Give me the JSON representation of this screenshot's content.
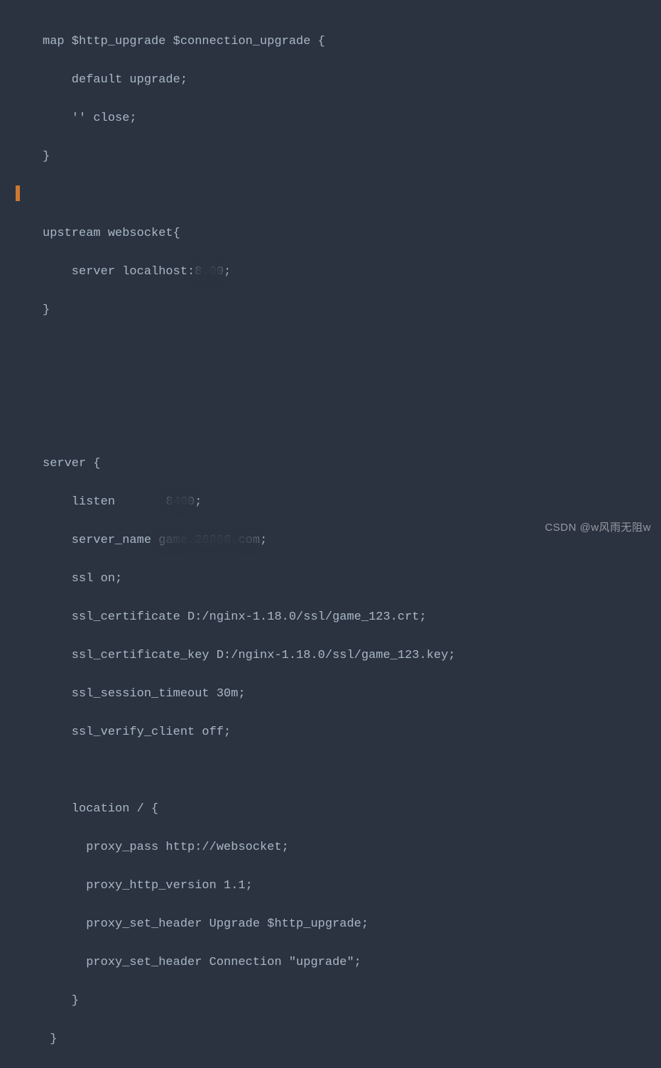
{
  "code": {
    "lines": [
      "map $http_upgrade $connection_upgrade {",
      "    default upgrade;",
      "    '' close;",
      "}",
      "",
      "upstream websocket{",
      "    server localhost:",
      "}",
      "",
      "",
      "",
      "server {",
      "    listen       ",
      "    server_name ",
      "    ssl on;",
      "    ssl_certificate D:/nginx-1.18.0/ssl/game_123.crt;",
      "    ssl_certificate_key D:/nginx-1.18.0/ssl/game_123.key;",
      "    ssl_session_timeout 30m;",
      "    ssl_verify_client off;",
      "    ",
      "    location / {",
      "      proxy_pass http://websocket;",
      "      proxy_http_version 1.1;",
      "      proxy_set_header Upgrade $http_upgrade;",
      "      proxy_set_header Connection \"upgrade\";",
      "    }",
      " }"
    ],
    "redacted": {
      "line6_suffix": "8.00",
      "line6_end": ";",
      "line12_suffix": "8400",
      "line12_end": ";",
      "line13_suffix": "game.26866.com",
      "line13_end": ";"
    }
  },
  "watermark": "CSDN @w风雨无阻w"
}
